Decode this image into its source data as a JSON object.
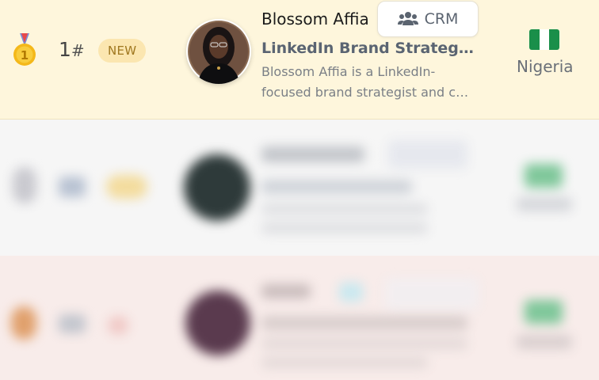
{
  "rows": [
    {
      "rank_number": "1",
      "rank_suffix": "#",
      "badge": "NEW",
      "name": "Blossom Affia",
      "crm_label": "CRM",
      "crm_icon": "users-icon",
      "headline": "LinkedIn Brand Strategist & Content Coach",
      "description_line1": "Blossom Affia is a LinkedIn-",
      "description_line2": "focused brand strategist and content coach",
      "country": "Nigeria",
      "flag_colors": [
        "#1a8f4a",
        "#ffffff",
        "#1a8f4a"
      ],
      "medal": "gold-medal-icon"
    },
    {
      "medal": "silver-medal-icon",
      "country": "Nigeria",
      "flag_colors": [
        "#1a8f4a",
        "#ffffff",
        "#1a8f4a"
      ]
    },
    {
      "medal": "bronze-medal-icon",
      "country": "Nigeria",
      "flag_colors": [
        "#1a8f4a",
        "#ffffff",
        "#1a8f4a"
      ]
    }
  ],
  "colors": {
    "row1_bg": "#fef6dc",
    "row2_bg": "#f6f6f6",
    "row3_bg": "#f8ecea",
    "badge_bg": "#fbe6b0",
    "badge_text": "#a07820"
  }
}
